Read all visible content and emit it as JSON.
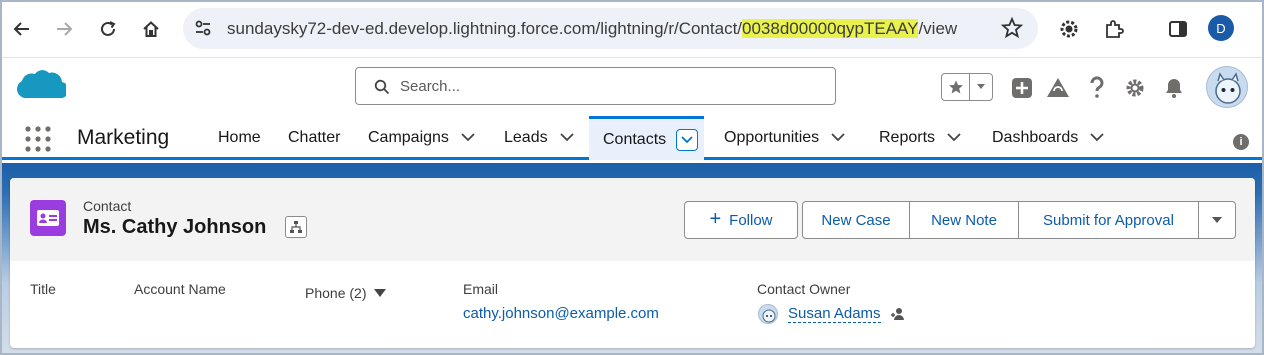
{
  "browser": {
    "url_prefix": "sundaysky72-dev-ed.develop.lightning.force.com/lightning/r/Contact/",
    "url_highlight": "0038d00000qypTEAAY",
    "url_suffix": "/view",
    "profile_initial": "D",
    "highlight_color": "#e9f24c"
  },
  "header": {
    "search_placeholder": "Search..."
  },
  "nav": {
    "app_name": "Marketing",
    "items": [
      {
        "label": "Home",
        "has_menu": false
      },
      {
        "label": "Chatter",
        "has_menu": false
      },
      {
        "label": "Campaigns",
        "has_menu": true
      },
      {
        "label": "Leads",
        "has_menu": true
      },
      {
        "label": "Contacts",
        "has_menu": true,
        "active": true
      },
      {
        "label": "Opportunities",
        "has_menu": true
      },
      {
        "label": "Reports",
        "has_menu": true
      },
      {
        "label": "Dashboards",
        "has_menu": true
      }
    ],
    "accent": "#0176d3"
  },
  "record": {
    "type": "Contact",
    "name": "Ms. Cathy Johnson",
    "icon_color": "#9b3ce0",
    "actions": {
      "follow": "Follow",
      "new_case": "New Case",
      "new_note": "New Note",
      "submit_for_approval": "Submit for Approval"
    },
    "fields": {
      "title_label": "Title",
      "account_label": "Account Name",
      "phone_label": "Phone (2)",
      "email_label": "Email",
      "email_value": "cathy.johnson@example.com",
      "owner_label": "Contact Owner",
      "owner_value": "Susan Adams"
    }
  }
}
